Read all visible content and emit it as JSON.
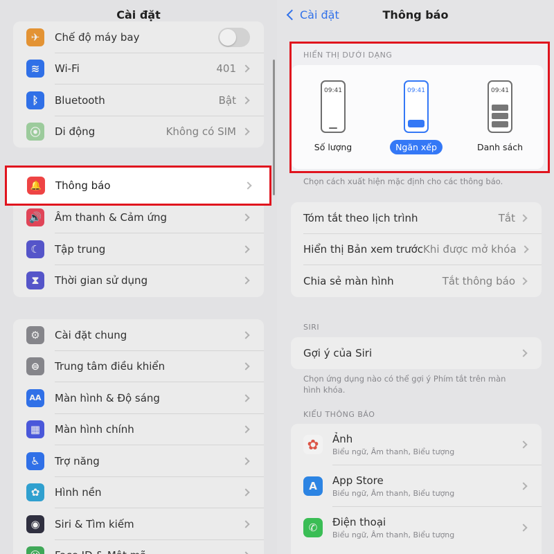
{
  "left": {
    "title": "Cài đặt",
    "group1": [
      {
        "label": "Chế độ máy bay",
        "value": "",
        "icon": "airplane-icon",
        "color": "#f29d38",
        "glyph": "✈",
        "toggle": true
      },
      {
        "label": "Wi-Fi",
        "value": "401",
        "icon": "wifi-icon",
        "color": "#3478f6",
        "glyph": "≋"
      },
      {
        "label": "Bluetooth",
        "value": "Bật",
        "icon": "bluetooth-icon",
        "color": "#3478f6",
        "glyph": "ᛒ"
      },
      {
        "label": "Di động",
        "value": "Không có SIM",
        "icon": "cellular-icon",
        "color": "#a6d8a6",
        "glyph": "⦿"
      }
    ],
    "highlighted": {
      "label": "Thông báo",
      "icon": "notification-icon",
      "color": "#ee4444",
      "glyph": "🔔"
    },
    "group2": [
      {
        "label": "Âm thanh & Cảm ứng",
        "icon": "sound-icon",
        "color": "#ee4a5e",
        "glyph": "🔊"
      },
      {
        "label": "Tập trung",
        "icon": "focus-moon-icon",
        "color": "#5b5bd6",
        "glyph": "☾"
      },
      {
        "label": "Thời gian sử dụng",
        "icon": "screen-time-icon",
        "color": "#5b5bd6",
        "glyph": "⧗"
      }
    ],
    "group3": [
      {
        "label": "Cài đặt chung",
        "icon": "gear-icon",
        "color": "#8e8e93",
        "glyph": "⚙"
      },
      {
        "label": "Trung tâm điều khiển",
        "icon": "control-center-icon",
        "color": "#8e8e93",
        "glyph": "⊜"
      },
      {
        "label": "Màn hình & Độ sáng",
        "icon": "display-brightness-icon",
        "color": "#3478f6",
        "glyph": "AA"
      },
      {
        "label": "Màn hình chính",
        "icon": "home-screen-icon",
        "color": "#4f5ee8",
        "glyph": "▦"
      },
      {
        "label": "Trợ năng",
        "icon": "accessibility-icon",
        "color": "#3478f6",
        "glyph": "♿"
      },
      {
        "label": "Hình nền",
        "icon": "wallpaper-icon",
        "color": "#34aadc",
        "glyph": "✿"
      },
      {
        "label": "Siri & Tìm kiếm",
        "icon": "siri-icon",
        "color": "#333344",
        "glyph": "◉"
      },
      {
        "label": "Face ID & Mật mã",
        "icon": "face-id-icon",
        "color": "#44b35e",
        "glyph": "☺"
      }
    ]
  },
  "right": {
    "back_label": "Cài đặt",
    "title": "Thông báo",
    "display_section": "HIỂN THỊ DƯỚI DẠNG",
    "styles": [
      {
        "label": "Số lượng",
        "time": "09:41",
        "selected": false
      },
      {
        "label": "Ngăn xếp",
        "time": "09:41",
        "selected": true
      },
      {
        "label": "Danh sách",
        "time": "09:41",
        "selected": false
      }
    ],
    "display_footer": "Chọn cách xuất hiện mặc định cho các thông báo.",
    "group1": [
      {
        "label": "Tóm tắt theo lịch trình",
        "value": "Tắt"
      },
      {
        "label": "Hiển thị Bản xem trước",
        "value": "Khi được mở khóa"
      },
      {
        "label": "Chia sẻ màn hình",
        "value": "Tắt thông báo"
      }
    ],
    "siri_section": "SIRI",
    "siri_row": {
      "label": "Gợi ý của Siri"
    },
    "siri_footer": "Chọn ứng dụng nào có thể gợi ý Phím tắt trên màn hình khóa.",
    "apps_section": "KIỂU THÔNG BÁO",
    "apps": [
      {
        "name": "Ảnh",
        "sub": "Biểu ngữ, Âm thanh, Biểu tượng",
        "icon": "photos-icon",
        "color": "#ffffff",
        "glyph": "✿"
      },
      {
        "name": "App Store",
        "sub": "Biểu ngữ, Âm thanh, Biểu tượng",
        "icon": "app-store-icon",
        "color": "#2f8cf0",
        "glyph": "A"
      },
      {
        "name": "Điện thoại",
        "sub": "Biểu ngữ, Âm thanh, Biểu tượng",
        "icon": "phone-icon",
        "color": "#3ec85a",
        "glyph": "✆"
      }
    ],
    "highlight_color": "#e0141e",
    "accent": "#3478f6"
  }
}
